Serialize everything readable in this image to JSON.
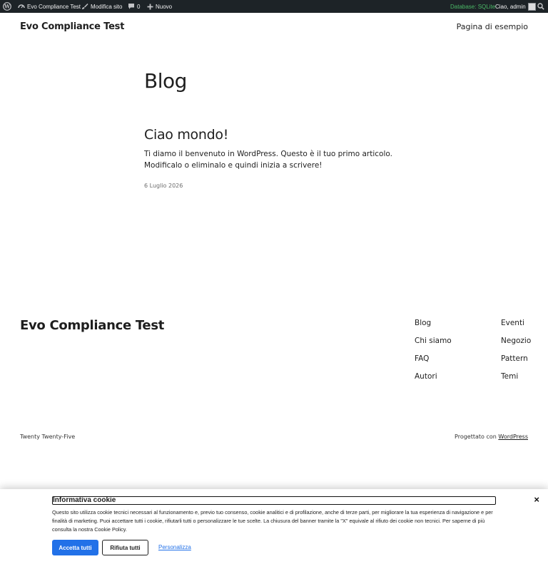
{
  "adminbar": {
    "site_name": "Evo Compliance Test",
    "edit_site": "Modifica sito",
    "comments_count": "0",
    "new_label": "Nuovo",
    "database": "Database: SQLite",
    "greeting": "Ciao, admin",
    "icons": [
      "wordpress-logo-icon",
      "dashboard-icon",
      "brush-icon",
      "comment-icon",
      "plus-icon",
      "search-icon"
    ]
  },
  "header": {
    "site_title": "Evo Compliance Test",
    "nav_link": "Pagina di esempio"
  },
  "main": {
    "page_title": "Blog",
    "post": {
      "title": "Ciao mondo!",
      "excerpt": "Ti diamo il benvenuto in WordPress. Questo è il tuo primo articolo. Modificalo o eliminalo e quindi inizia a scrivere!",
      "date": "6 Luglio 2026"
    }
  },
  "footer": {
    "site_title": "Evo Compliance Test",
    "links_col1": [
      "Blog",
      "Chi siamo",
      "FAQ",
      "Autori"
    ],
    "links_col2": [
      "Eventi",
      "Negozio",
      "Pattern",
      "Temi"
    ],
    "theme_name": "Twenty Twenty-Five",
    "credit_prefix": "Progettato con",
    "credit_link": "WordPress"
  },
  "cookie_banner": {
    "title": "Informativa cookie",
    "close": "×",
    "text": "Questo sito utilizza cookie tecnici necessari al funzionamento e, previo tuo consenso, cookie analitici e di profilazione, anche di terze parti, per migliorare la tua esperienza di navigazione e per finalità di marketing. Puoi accettare tutti i cookie, rifiutarli tutti o personalizzare le tue scelte. La chiusura del banner tramite la \"X\" equivale al rifiuto dei cookie non tecnici. Per saperne di più consulta la nostra Cookie Policy.",
    "accept": "Accetta tutti",
    "reject": "Rifiuta tutti",
    "customize": "Personalizza",
    "accent_color": "#2271e8"
  }
}
